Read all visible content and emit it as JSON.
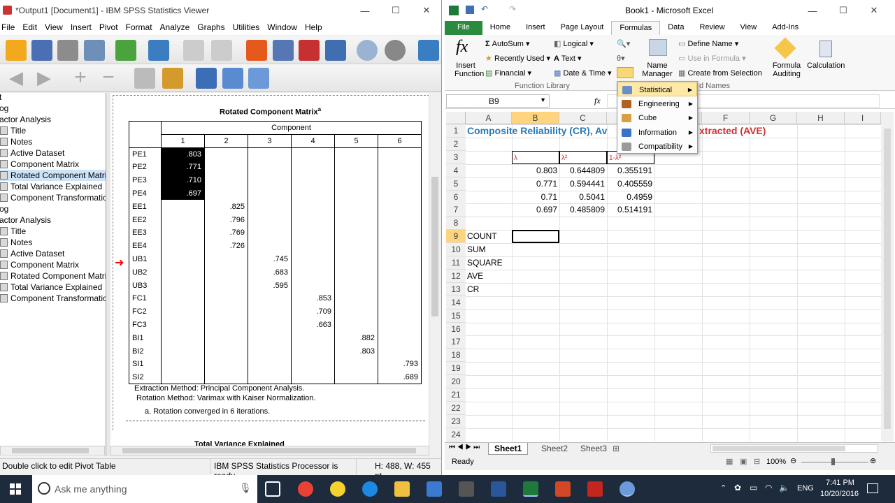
{
  "spss": {
    "title": "*Output1 [Document1] - IBM SPSS Statistics Viewer",
    "menu": [
      "File",
      "Edit",
      "View",
      "Insert",
      "Pivot",
      "Format",
      "Analyze",
      "Graphs",
      "Utilities",
      "Window",
      "Help"
    ],
    "outline": [
      {
        "label": "t",
        "indent": 0
      },
      {
        "label": "og",
        "indent": 0
      },
      {
        "label": "actor Analysis",
        "indent": 0
      },
      {
        "label": "Title",
        "indent": 1
      },
      {
        "label": "Notes",
        "indent": 1
      },
      {
        "label": "Active Dataset",
        "indent": 1
      },
      {
        "label": "Component Matrix",
        "indent": 1
      },
      {
        "label": "Rotated Component Matri",
        "indent": 1,
        "selected": true
      },
      {
        "label": "Total Variance Explained",
        "indent": 1
      },
      {
        "label": "Component Transformatio",
        "indent": 1
      },
      {
        "label": "og",
        "indent": 0
      },
      {
        "label": "actor Analysis",
        "indent": 0
      },
      {
        "label": "Title",
        "indent": 1
      },
      {
        "label": "Notes",
        "indent": 1
      },
      {
        "label": "Active Dataset",
        "indent": 1
      },
      {
        "label": "Component Matrix",
        "indent": 1
      },
      {
        "label": "Rotated Component Matri",
        "indent": 1
      },
      {
        "label": "Total Variance Explained",
        "indent": 1
      },
      {
        "label": "Component Transformatio",
        "indent": 1
      }
    ],
    "pivot": {
      "title": "Rotated Component Matrix",
      "title_sup": "a",
      "component_header": "Component",
      "columns": [
        "1",
        "2",
        "3",
        "4",
        "5",
        "6"
      ],
      "rows": [
        {
          "label": "PE1",
          "col": 0,
          "value": ".803",
          "hl": true
        },
        {
          "label": "PE2",
          "col": 0,
          "value": ".771",
          "hl": true
        },
        {
          "label": "PE3",
          "col": 0,
          "value": ".710",
          "hl": true
        },
        {
          "label": "PE4",
          "col": 0,
          "value": ".697",
          "hl": true
        },
        {
          "label": "EE1",
          "col": 1,
          "value": ".825"
        },
        {
          "label": "EE2",
          "col": 1,
          "value": ".796"
        },
        {
          "label": "EE3",
          "col": 1,
          "value": ".769"
        },
        {
          "label": "EE4",
          "col": 1,
          "value": ".726"
        },
        {
          "label": "UB1",
          "col": 2,
          "value": ".745"
        },
        {
          "label": "UB2",
          "col": 2,
          "value": ".683"
        },
        {
          "label": "UB3",
          "col": 2,
          "value": ".595"
        },
        {
          "label": "FC1",
          "col": 3,
          "value": ".853"
        },
        {
          "label": "FC2",
          "col": 3,
          "value": ".709"
        },
        {
          "label": "FC3",
          "col": 3,
          "value": ".663"
        },
        {
          "label": "BI1",
          "col": 4,
          "value": ".882"
        },
        {
          "label": "BI2",
          "col": 4,
          "value": ".803"
        },
        {
          "label": "SI1",
          "col": 5,
          "value": ".793"
        },
        {
          "label": "SI2",
          "col": 5,
          "value": ".689"
        }
      ],
      "footnote1": "Extraction Method: Principal Component Analysis.",
      "footnote2": "Rotation Method: Varimax with Kaiser Normalization.",
      "footnote3": "a. Rotation converged in 6 iterations.",
      "next_title": "Total Variance Explained"
    },
    "status_left": "Double click to edit Pivot Table",
    "status_mid": "IBM SPSS Statistics Processor is ready",
    "status_right": "H: 488, W: 455 pt."
  },
  "excel": {
    "title": "Book1 - Microsoft Excel",
    "tabs": [
      "File",
      "Home",
      "Insert",
      "Page Layout",
      "Formulas",
      "Data",
      "Review",
      "View",
      "Add-Ins"
    ],
    "active_tab": "Formulas",
    "ribbon": {
      "insert_function": "Insert Function",
      "autosum": "AutoSum",
      "recently_used": "Recently Used",
      "financial": "Financial",
      "logical": "Logical",
      "text": "Text",
      "date_time": "Date & Time",
      "group_function_library": "Function Library",
      "name_manager": "Name Manager",
      "define_name": "Define Name",
      "use_in_formula": "Use in Formula",
      "create_from_selection": "Create from Selection",
      "group_defined_names": "d Names",
      "formula_auditing": "Formula Auditing",
      "calculation": "Calculation"
    },
    "name_box": "B9",
    "fx": "fx",
    "columns": [
      "A",
      "B",
      "C",
      "D",
      "E",
      "F",
      "G",
      "H",
      "I"
    ],
    "rows": [
      "1",
      "2",
      "3",
      "4",
      "5",
      "6",
      "7",
      "8",
      "9",
      "10",
      "11",
      "12",
      "13",
      "14",
      "15",
      "16",
      "17",
      "18",
      "19",
      "20",
      "21",
      "22",
      "23",
      "24"
    ],
    "title_text_blue": "Composite Reliability (CR), Av",
    "title_text_red": "xtracted (AVE)",
    "header_b3": "λ",
    "header_c3": "λ²",
    "header_d3": "1-λ²",
    "data": [
      [
        "0.803",
        "0.644809",
        "0.355191"
      ],
      [
        "0.771",
        "0.594441",
        "0.405559"
      ],
      [
        "0.71",
        "0.5041",
        "0.4959"
      ],
      [
        "0.697",
        "0.485809",
        "0.514191"
      ]
    ],
    "labels": [
      "COUNT",
      "SUM",
      "SQUARE",
      "AVE",
      "CR"
    ],
    "dropdown": [
      "Statistical",
      "Engineering",
      "Cube",
      "Information",
      "Compatibility"
    ],
    "sheets": [
      "Sheet1",
      "Sheet2",
      "Sheet3"
    ],
    "status": "Ready",
    "zoom": "100%"
  },
  "taskbar": {
    "search_placeholder": "Ask me anything",
    "lang": "ENG",
    "time": "7:41 PM",
    "date": "10/20/2016"
  }
}
